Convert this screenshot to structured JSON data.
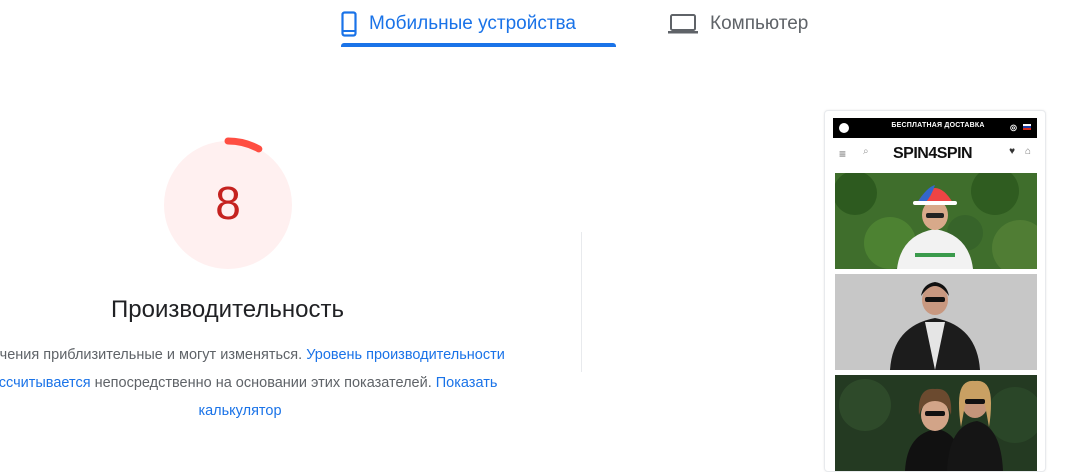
{
  "tabs": [
    {
      "label": "Мобильные устройства",
      "icon": "smartphone-icon",
      "active": true
    },
    {
      "label": "Компьютер",
      "icon": "laptop-icon",
      "active": false
    }
  ],
  "metric": {
    "score": "8",
    "gauge_fraction": 0.08,
    "title": "Производительность",
    "desc_part1": "Значения приблизительные и могут изменяться. ",
    "desc_link1": "Уровень производительности рассчитывается",
    "desc_part2": " непосредственно на основании этих показателей. ",
    "desc_link2": "Показать калькулятор"
  },
  "preview": {
    "promo": "БЕСПЛАТНАЯ ДОСТАВКА",
    "logo": "SPIN4SPIN"
  },
  "colors": {
    "accent": "#1a73e8",
    "fail": "#ff4e42",
    "fail_text": "#c5221f",
    "gauge_bg": "#fff0f0"
  }
}
